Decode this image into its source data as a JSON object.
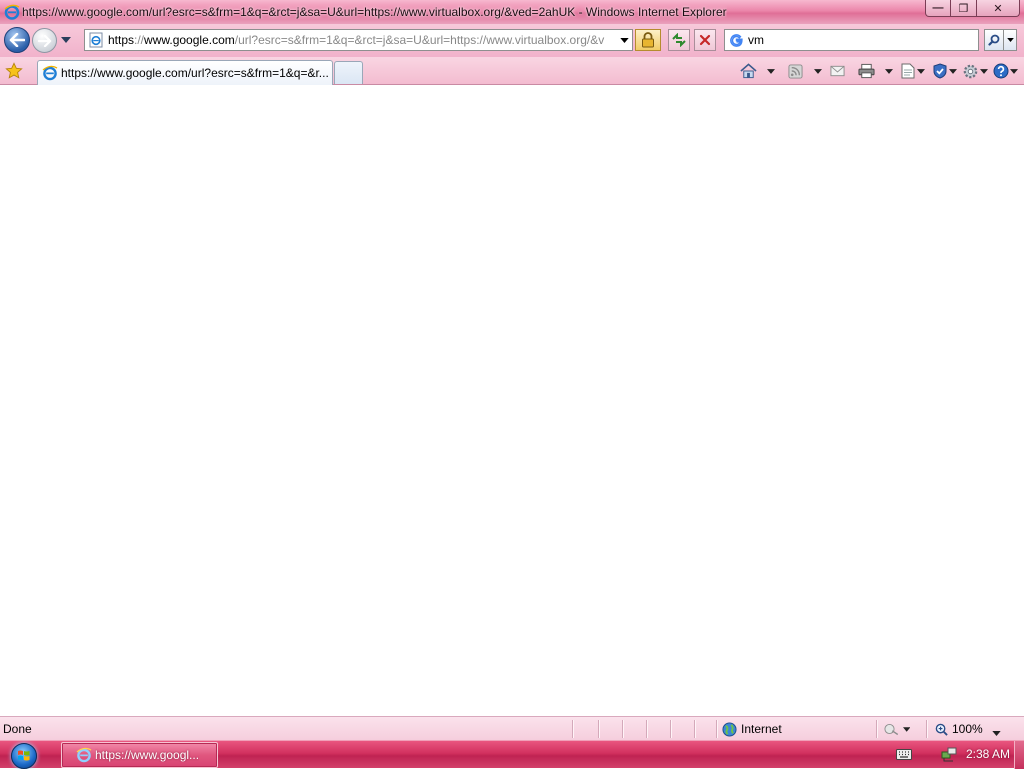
{
  "window": {
    "title": "https://www.google.com/url?esrc=s&frm=1&q=&rct=j&sa=U&url=https://www.virtualbox.org/&ved=2ahUK - Windows Internet Explorer",
    "minimize_glyph": "—",
    "maximize_glyph": "❐",
    "close_glyph": "✕"
  },
  "navbar": {
    "address": {
      "scheme": "https",
      "host": "www.google.com",
      "rest": "/url?esrc=s&frm=1&q=&rct=j&sa=U&url=https://www.virtualbox.org/&v"
    },
    "search": {
      "value": "vm",
      "provider_icon": "google-icon"
    }
  },
  "tabs": [
    {
      "label": "https://www.google.com/url?esrc=s&frm=1&q=&r..."
    }
  ],
  "commandbar": {
    "icons": [
      "home-icon",
      "feeds-icon",
      "read-mail-icon",
      "print-icon",
      "page-icon",
      "safety-icon",
      "tools-icon",
      "help-icon"
    ]
  },
  "statusbar": {
    "status": "Done",
    "zone": "Internet",
    "zoom": "100%"
  },
  "taskbar": {
    "button_label": "https://www.googl...",
    "clock": "2:38 AM"
  },
  "colors": {
    "chrome_pink": "#f3bcd0",
    "taskbar_pink": "#d2315f",
    "content_bg": "#ffffff"
  }
}
